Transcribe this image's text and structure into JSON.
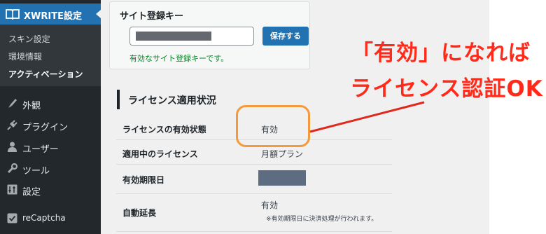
{
  "sidebar": {
    "plugin_title": "XWRITE設定",
    "submenu": [
      "スキン設定",
      "環境情報",
      "アクティベーション"
    ],
    "menu": [
      {
        "label": "外観",
        "icon": "paintbrush-icon"
      },
      {
        "label": "プラグイン",
        "icon": "plugin-icon"
      },
      {
        "label": "ユーザー",
        "icon": "user-icon"
      },
      {
        "label": "ツール",
        "icon": "wrench-icon"
      },
      {
        "label": "設定",
        "icon": "settings-icon"
      },
      {
        "label": "reCaptcha",
        "icon": "checkbox-icon"
      }
    ]
  },
  "key_section": {
    "title": "サイト登録キー",
    "save_label": "保存する",
    "valid_message": "有効なサイト登録キーです。"
  },
  "license": {
    "title": "ライセンス適用状況",
    "rows": [
      {
        "label": "ライセンスの有効状態",
        "value": "有効"
      },
      {
        "label": "適用中のライセンス",
        "value": "月額プラン"
      },
      {
        "label": "有効期限日",
        "value": ""
      },
      {
        "label": "自動延長",
        "value": "有効"
      }
    ],
    "auto_renew_note": "※有効期限日に決済処理が行われます。"
  },
  "annotation": {
    "line1": "「有効」になれば",
    "line2": "ライセンス認証OK!",
    "color": "#ff2a1a",
    "highlight_color": "#f59a3a"
  }
}
